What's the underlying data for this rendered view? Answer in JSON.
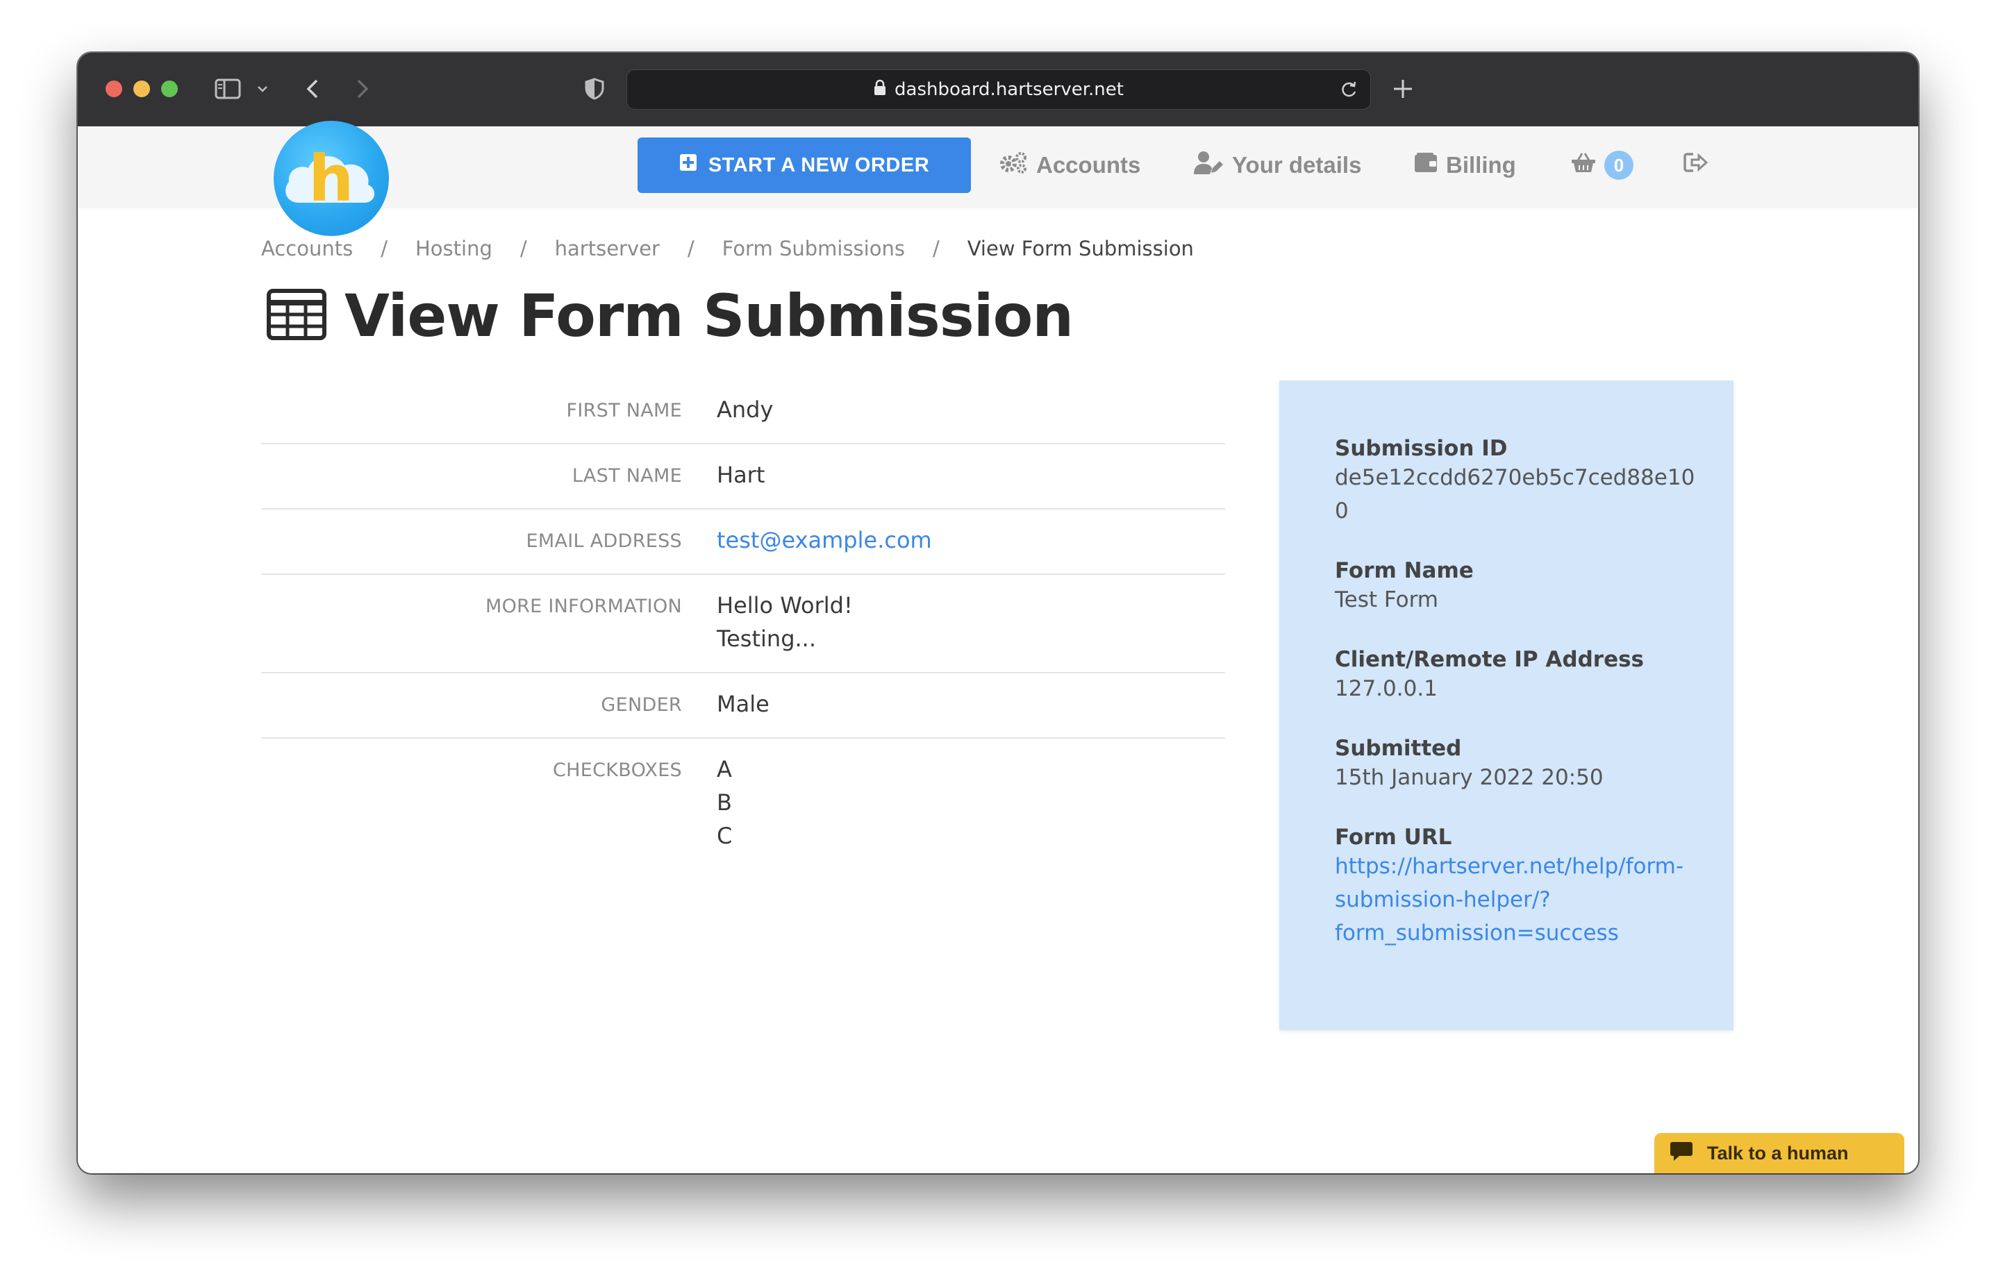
{
  "browser": {
    "url": "dashboard.hartserver.net"
  },
  "nav": {
    "logo_letter": "h",
    "new_order_label": "START A NEW ORDER",
    "accounts_label": "Accounts",
    "your_details_label": "Your details",
    "billing_label": "Billing",
    "cart_count": "0"
  },
  "breadcrumb": {
    "items": [
      "Accounts",
      "Hosting",
      "hartserver",
      "Form Submissions",
      "View Form Submission"
    ],
    "separator": "/"
  },
  "page": {
    "title": "View Form Submission"
  },
  "fields": [
    {
      "label": "FIRST NAME",
      "lines": [
        "Andy"
      ]
    },
    {
      "label": "LAST NAME",
      "lines": [
        "Hart"
      ]
    },
    {
      "label": "EMAIL ADDRESS",
      "lines": [
        "test@example.com"
      ]
    },
    {
      "label": "MORE INFORMATION",
      "lines": [
        "Hello World!",
        "Testing..."
      ]
    },
    {
      "label": "GENDER",
      "lines": [
        "Male"
      ]
    },
    {
      "label": "CHECKBOXES",
      "lines": [
        "A",
        "B",
        "C"
      ]
    }
  ],
  "panel": {
    "submission_id_label": "Submission ID",
    "submission_id": "de5e12ccdd6270eb5c7ced88e100",
    "form_name_label": "Form Name",
    "form_name": "Test Form",
    "ip_label": "Client/Remote IP Address",
    "ip": "127.0.0.1",
    "submitted_label": "Submitted",
    "submitted": "15th January 2022 20:50",
    "form_url_label": "Form URL",
    "form_url": "https://hartserver.net/help/form-submission-helper/?form_submission=success"
  },
  "chat": {
    "label": "Talk to a human"
  },
  "colors": {
    "accent": "#3a87e8",
    "panel_bg": "#d3e6fa",
    "chat_bg": "#f2c038"
  }
}
